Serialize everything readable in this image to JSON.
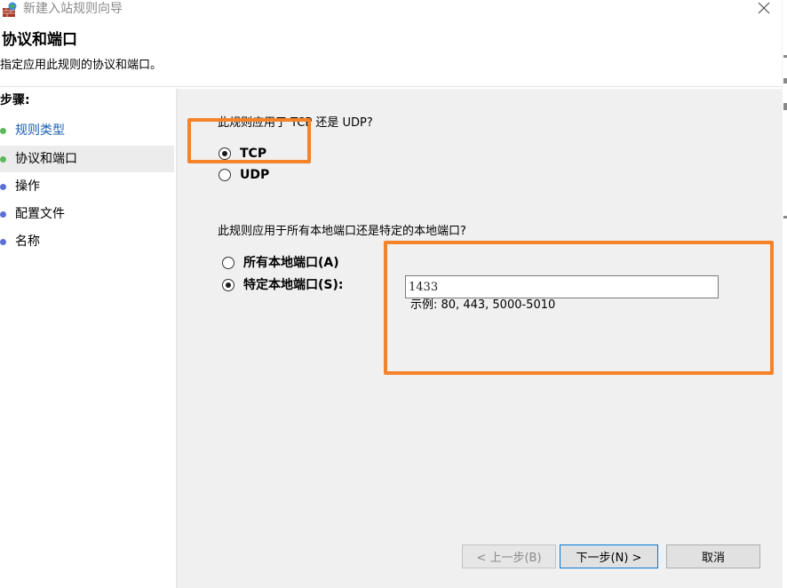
{
  "window": {
    "title": "新建入站规则向导",
    "close_icon": "close-icon"
  },
  "header": {
    "title": "协议和端口",
    "subtitle": "指定应用此规则的协议和端口。"
  },
  "steps": {
    "title": "步骤:",
    "items": [
      {
        "label": "规则类型",
        "state": "done",
        "dot_color": "#5cb85c"
      },
      {
        "label": "协议和端口",
        "state": "current",
        "dot_color": "#5cb85c"
      },
      {
        "label": "操作",
        "state": "pending",
        "dot_color": "#5b6fd6"
      },
      {
        "label": "配置文件",
        "state": "pending",
        "dot_color": "#5b6fd6"
      },
      {
        "label": "名称",
        "state": "pending",
        "dot_color": "#5b6fd6"
      }
    ]
  },
  "protocol": {
    "question": "此规则应用于 TCP 还是 UDP?",
    "options": [
      {
        "label": "TCP",
        "checked": true
      },
      {
        "label": "UDP",
        "checked": false
      }
    ]
  },
  "ports": {
    "question": "此规则应用于所有本地端口还是特定的本地端口?",
    "options": [
      {
        "label": "所有本地端口(A)",
        "checked": false
      },
      {
        "label": "特定本地端口(S):",
        "checked": true
      }
    ],
    "value": "1433",
    "example": "示例: 80, 443, 5000-5010"
  },
  "buttons": {
    "back": "< 上一步(B)",
    "next": "下一步(N) >",
    "cancel": "取消"
  },
  "colors": {
    "highlight": "#f4832a",
    "current_step_bg": "#ececec",
    "content_bg": "#f0f0f0"
  }
}
